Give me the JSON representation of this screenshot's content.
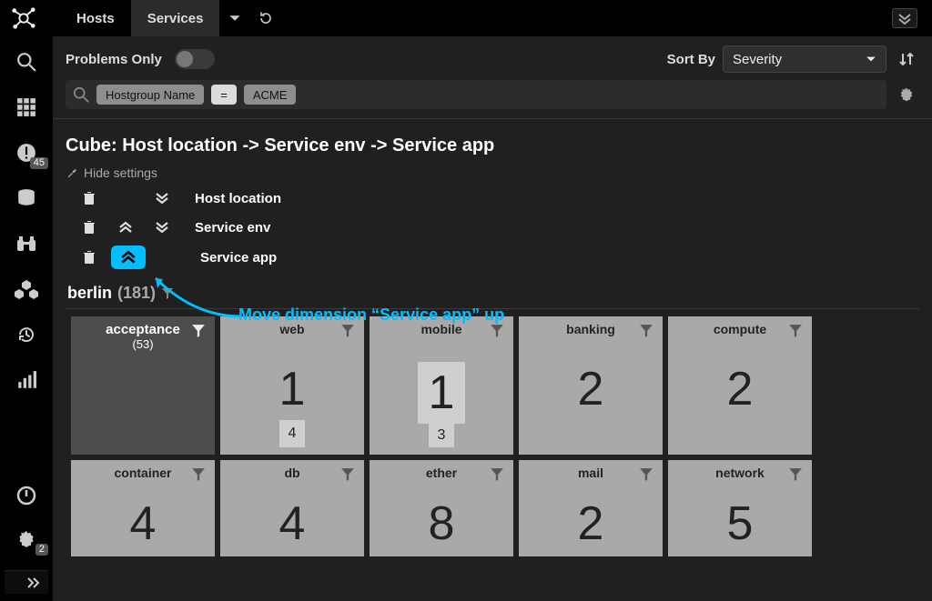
{
  "header": {
    "tabs": {
      "hosts": "Hosts",
      "services": "Services"
    }
  },
  "sidebar": {
    "problem_badge": "45",
    "settings_badge": "2"
  },
  "controls": {
    "problems_only_label": "Problems Only",
    "sort_by_label": "Sort By",
    "sort_field": "Severity"
  },
  "filter": {
    "field_chip": "Hostgroup Name",
    "op_chip": "=",
    "value_chip": "ACME"
  },
  "cube": {
    "title": "Cube: Host location -> Service env -> Service app",
    "hide_settings": "Hide settings",
    "dimensions": {
      "d0": "Host location",
      "d1": "Service env",
      "d2": "Service app"
    }
  },
  "annotation": {
    "text": "Move dimension “Service app” up"
  },
  "group": {
    "name": "berlin",
    "count": "(181)"
  },
  "tiles": {
    "r0c0_label": "acceptance",
    "r0c0_count": "(53)",
    "r0c1_label": "web",
    "r0c1_big": "1",
    "r0c1_sub": "4",
    "r0c2_label": "mobile",
    "r0c2_big": "1",
    "r0c2_sub": "3",
    "r0c3_label": "banking",
    "r0c3_big": "2",
    "r0c4_label": "compute",
    "r0c4_big": "2",
    "r1c0_label": "container",
    "r1c0_big": "4",
    "r1c1_label": "db",
    "r1c1_big": "4",
    "r1c2_label": "ether",
    "r1c2_big": "8",
    "r1c3_label": "mail",
    "r1c3_big": "2",
    "r1c4_label": "network",
    "r1c4_big": "5"
  },
  "chart_data": {
    "type": "table",
    "title": "Cube: Host location -> Service env -> Service app",
    "group": "berlin",
    "group_count": 181,
    "subgroup": "acceptance",
    "subgroup_count": 53,
    "rows": [
      {
        "app": "web",
        "value": 1,
        "secondary": 4
      },
      {
        "app": "mobile",
        "value": 1,
        "secondary": 3
      },
      {
        "app": "banking",
        "value": 2
      },
      {
        "app": "compute",
        "value": 2
      },
      {
        "app": "container",
        "value": 4
      },
      {
        "app": "db",
        "value": 4
      },
      {
        "app": "ether",
        "value": 8
      },
      {
        "app": "mail",
        "value": 2
      },
      {
        "app": "network",
        "value": 5
      }
    ]
  }
}
